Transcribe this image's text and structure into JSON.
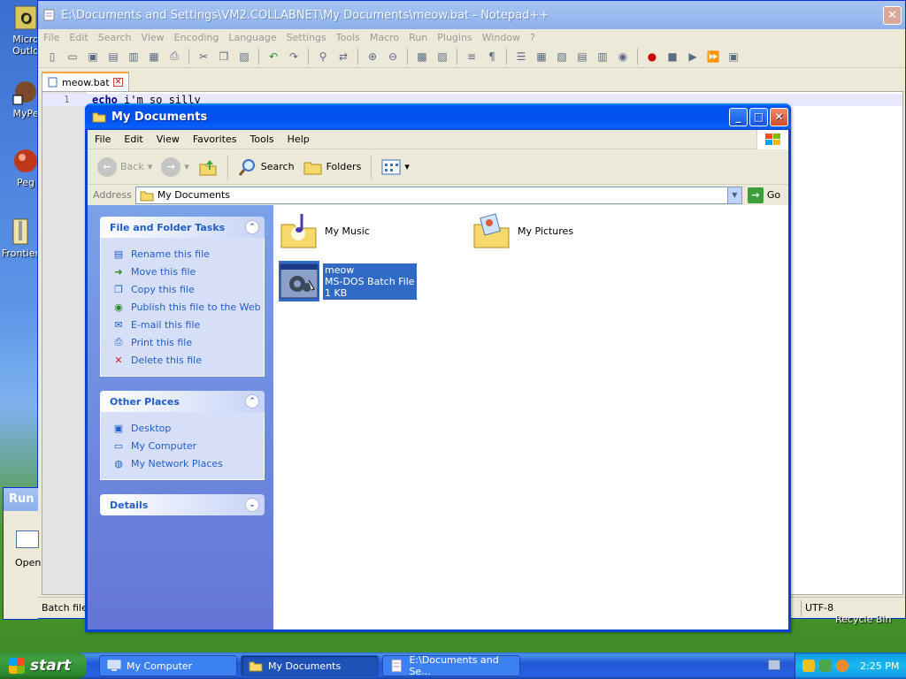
{
  "desktop": {
    "icons": [
      {
        "label": "Micro Outlo",
        "icon": "outlook-icon"
      },
      {
        "label": "MyPe",
        "icon": "shortcut-icon"
      },
      {
        "label": "Peg",
        "icon": "pegasus-icon"
      },
      {
        "label": "Frontier",
        "icon": "zip-icon"
      }
    ],
    "recycle_bin": "Recycle Bin"
  },
  "notepad": {
    "title": "E:\\Documents and Settings\\VM2.COLLABNET\\My Documents\\meow.bat - Notepad++",
    "menu": [
      "File",
      "Edit",
      "Search",
      "View",
      "Encoding",
      "Language",
      "Settings",
      "Tools",
      "Macro",
      "Run",
      "Plugins",
      "Window",
      "?"
    ],
    "tab": "meow.bat",
    "line_number": "1",
    "line_keyword": "echo",
    "line_rest": "i'm so silly",
    "status_left": "Batch file",
    "status_encoding": "UTF-8"
  },
  "run_dialog": {
    "title": "Run",
    "open_label": "Open"
  },
  "explorer": {
    "title": "My Documents",
    "menu": [
      "File",
      "Edit",
      "View",
      "Favorites",
      "Tools",
      "Help"
    ],
    "toolbar": {
      "back": "Back",
      "search": "Search",
      "folders": "Folders"
    },
    "address_label": "Address",
    "address_value": "My Documents",
    "go_label": "Go",
    "tasks_panel": {
      "title": "File and Folder Tasks",
      "items": [
        {
          "label": "Rename this file",
          "icon": "rename-icon"
        },
        {
          "label": "Move this file",
          "icon": "move-icon"
        },
        {
          "label": "Copy this file",
          "icon": "copy-icon"
        },
        {
          "label": "Publish this file to the Web",
          "icon": "publish-icon"
        },
        {
          "label": "E-mail this file",
          "icon": "email-icon"
        },
        {
          "label": "Print this file",
          "icon": "print-icon"
        },
        {
          "label": "Delete this file",
          "icon": "delete-icon"
        }
      ]
    },
    "places_panel": {
      "title": "Other Places",
      "items": [
        {
          "label": "Desktop",
          "icon": "desktop-icon"
        },
        {
          "label": "My Computer",
          "icon": "computer-icon"
        },
        {
          "label": "My Network Places",
          "icon": "network-icon"
        }
      ]
    },
    "details_panel": {
      "title": "Details"
    },
    "files": [
      {
        "name": "My Music",
        "icon": "music-folder-icon"
      },
      {
        "name": "My Pictures",
        "icon": "pictures-folder-icon"
      },
      {
        "name": "meow",
        "type": "MS-DOS Batch File",
        "size": "1 KB",
        "icon": "batch-file-icon",
        "selected": true
      }
    ]
  },
  "taskbar": {
    "start": "start",
    "buttons": [
      {
        "label": "My Computer",
        "icon": "computer-icon"
      },
      {
        "label": "My Documents",
        "icon": "folder-icon",
        "active": true
      },
      {
        "label": "E:\\Documents and Se...",
        "icon": "notepad-icon"
      }
    ],
    "clock": "2:25 PM"
  },
  "colors": {
    "xp_blue": "#0053ee",
    "selection": "#316ac5",
    "task_link": "#215dc6",
    "start_green": "#3f9f3f"
  }
}
